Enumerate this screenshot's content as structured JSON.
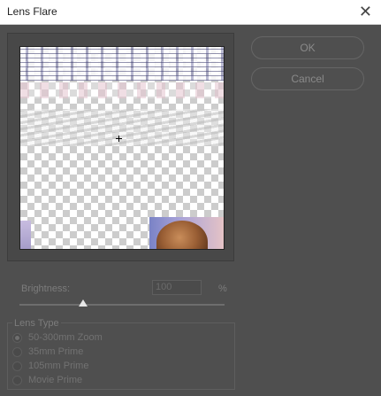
{
  "window": {
    "title": "Lens Flare",
    "close_glyph": "✕"
  },
  "buttons": {
    "ok": "OK",
    "cancel": "Cancel"
  },
  "brightness": {
    "label": "Brightness:",
    "value": "100",
    "unit": "%",
    "slider_fraction": 0.31
  },
  "lens_type": {
    "legend": "Lens Type",
    "options": [
      {
        "label": "50-300mm Zoom",
        "checked": true
      },
      {
        "label": "35mm Prime",
        "checked": false
      },
      {
        "label": "105mm Prime",
        "checked": false
      },
      {
        "label": "Movie Prime",
        "checked": false
      }
    ]
  }
}
